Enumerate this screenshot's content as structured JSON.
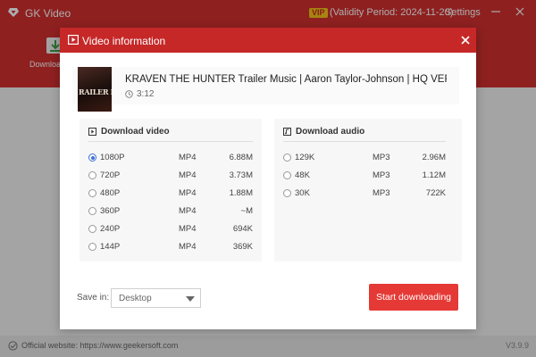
{
  "app": {
    "title": "GK Video",
    "vip_badge": "VIP",
    "validity": "(Validity Period: 2024-11-20)",
    "settings_label": "Settings",
    "download_label": "Download",
    "footer_text": "Official website: https://www.geekersoft.com",
    "version": "V3.9.9",
    "colors": {
      "brand_red": "#d23030",
      "dialog_red": "#c62828",
      "accent_blue": "#3b6fd4",
      "button_red": "#e53935"
    }
  },
  "dialog": {
    "title": "Video information",
    "video": {
      "title": "KRAVEN THE HUNTER Trailer Music | Aaron Taylor-Johnson | HQ VER...",
      "duration": "3:12",
      "thumbnail_text": "RAILER MUSI"
    },
    "video_section": {
      "label": "Download video",
      "options": [
        {
          "res": "1080P",
          "format": "MP4",
          "size": "6.88M",
          "selected": true
        },
        {
          "res": "720P",
          "format": "MP4",
          "size": "3.73M",
          "selected": false
        },
        {
          "res": "480P",
          "format": "MP4",
          "size": "1.88M",
          "selected": false
        },
        {
          "res": "360P",
          "format": "MP4",
          "size": "~M",
          "selected": false
        },
        {
          "res": "240P",
          "format": "MP4",
          "size": "694K",
          "selected": false
        },
        {
          "res": "144P",
          "format": "MP4",
          "size": "369K",
          "selected": false
        }
      ]
    },
    "audio_section": {
      "label": "Download audio",
      "options": [
        {
          "res": "129K",
          "format": "MP3",
          "size": "2.96M",
          "selected": false
        },
        {
          "res": "48K",
          "format": "MP3",
          "size": "1.12M",
          "selected": false
        },
        {
          "res": "30K",
          "format": "MP3",
          "size": "722K",
          "selected": false
        }
      ]
    },
    "save_in_label": "Save in:",
    "save_in_value": "Desktop",
    "start_button": "Start downloading"
  }
}
